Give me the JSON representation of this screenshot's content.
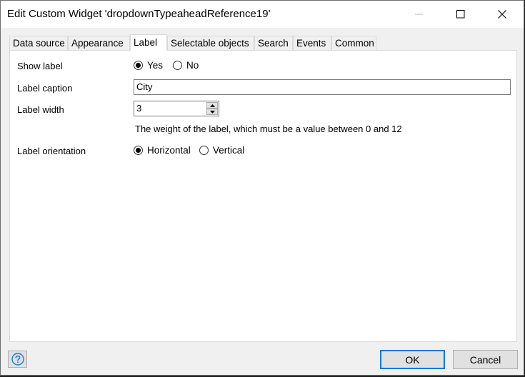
{
  "window": {
    "title": "Edit Custom Widget 'dropdownTypeaheadReference19'"
  },
  "tabs": [
    {
      "label": "Data source",
      "active": false
    },
    {
      "label": "Appearance",
      "active": false
    },
    {
      "label": "Label",
      "active": true
    },
    {
      "label": "Selectable objects",
      "active": false
    },
    {
      "label": "Search",
      "active": false
    },
    {
      "label": "Events",
      "active": false
    },
    {
      "label": "Common",
      "active": false
    }
  ],
  "form": {
    "show_label": {
      "label": "Show label",
      "options": [
        {
          "label": "Yes",
          "checked": true
        },
        {
          "label": "No",
          "checked": false
        }
      ]
    },
    "label_caption": {
      "label": "Label caption",
      "value": "City"
    },
    "label_width": {
      "label": "Label width",
      "value": "3",
      "hint": "The weight of the label, which must be a value between 0 and 12"
    },
    "label_orientation": {
      "label": "Label orientation",
      "options": [
        {
          "label": "Horizontal",
          "checked": true
        },
        {
          "label": "Vertical",
          "checked": false
        }
      ]
    }
  },
  "footer": {
    "help_icon": "help-icon",
    "ok_label": "OK",
    "cancel_label": "Cancel"
  },
  "colors": {
    "accent": "#0078d7",
    "help_icon": "#1e7ad1"
  }
}
